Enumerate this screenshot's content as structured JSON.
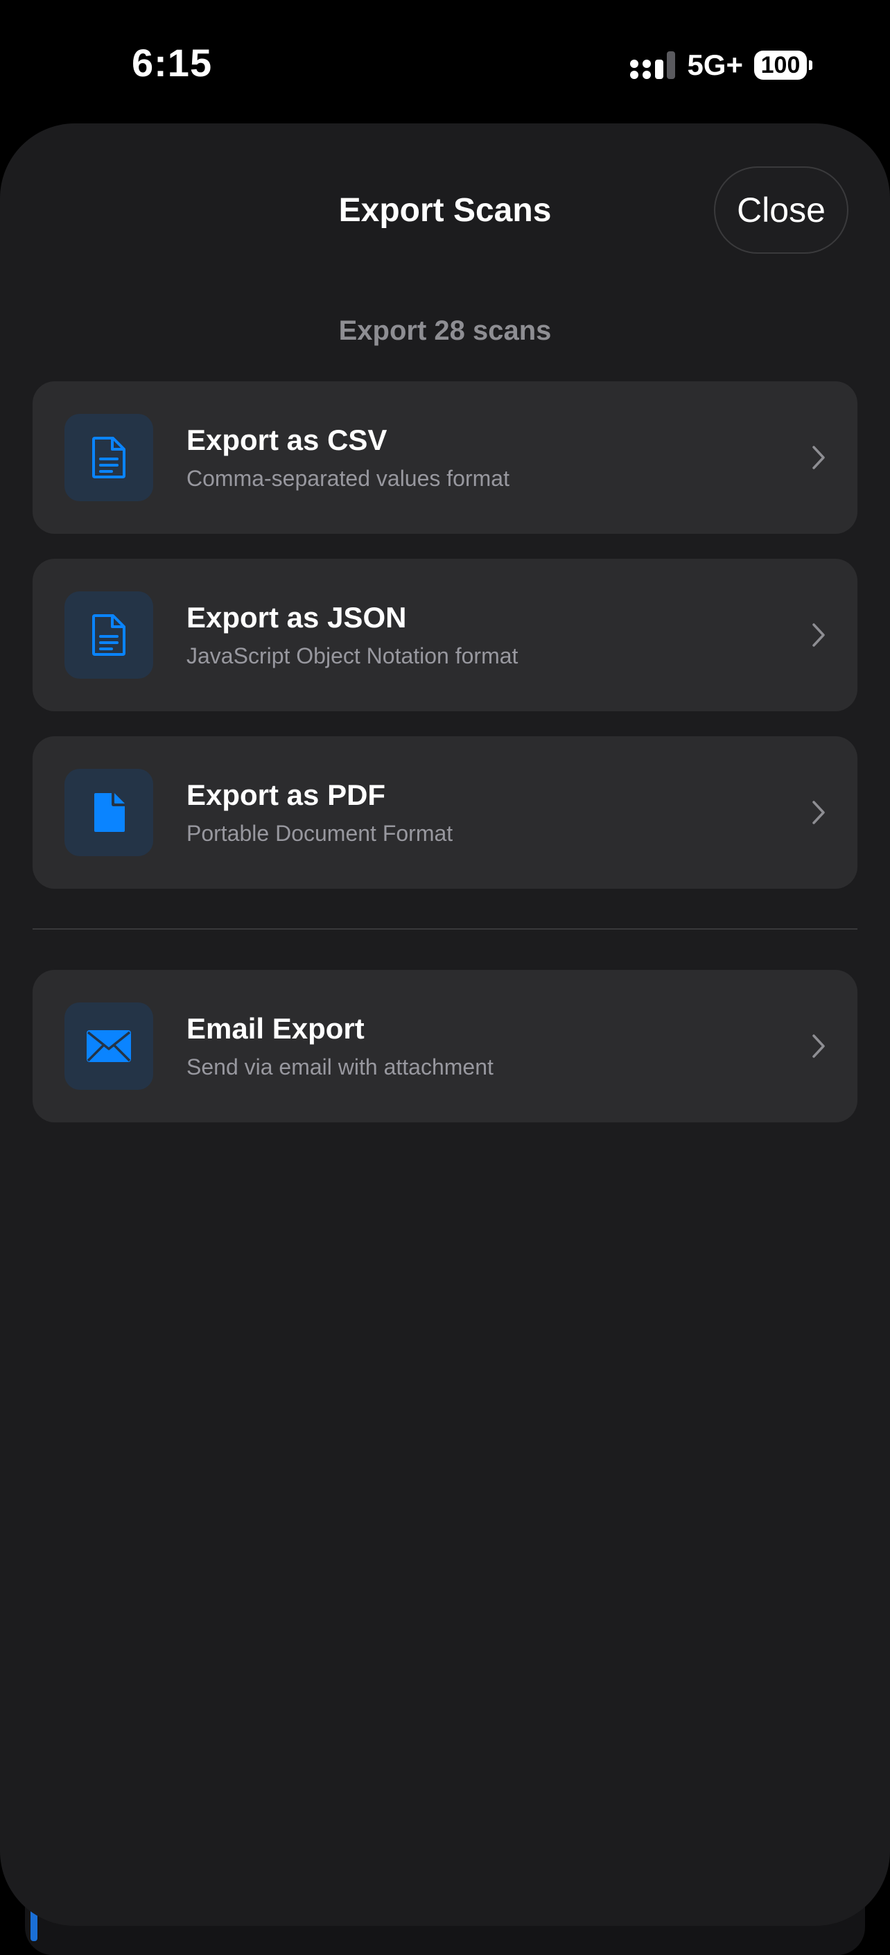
{
  "status_bar": {
    "time": "6:15",
    "network": "5G+",
    "battery": "100",
    "icons": [
      "cellular-signal-icon",
      "battery-icon"
    ]
  },
  "sheet": {
    "title": "Export Scans",
    "close_label": "Close",
    "subtitle": "Export 28 scans"
  },
  "options": [
    {
      "title": "Export as CSV",
      "description": "Comma-separated values format",
      "icon": "document-text-icon"
    },
    {
      "title": "Export as JSON",
      "description": "JavaScript Object Notation format",
      "icon": "document-text-icon"
    },
    {
      "title": "Export as PDF",
      "description": "Portable Document Format",
      "icon": "document-filled-icon"
    },
    {
      "title": "Email Export",
      "description": "Send via email with attachment",
      "icon": "envelope-icon"
    }
  ],
  "colors": {
    "background": "#000000",
    "sheet": "#1c1c1e",
    "card": "#2c2c2e",
    "icon_tile": "#243447",
    "accent": "#0a84ff",
    "secondary_text": "#8e8e93"
  }
}
